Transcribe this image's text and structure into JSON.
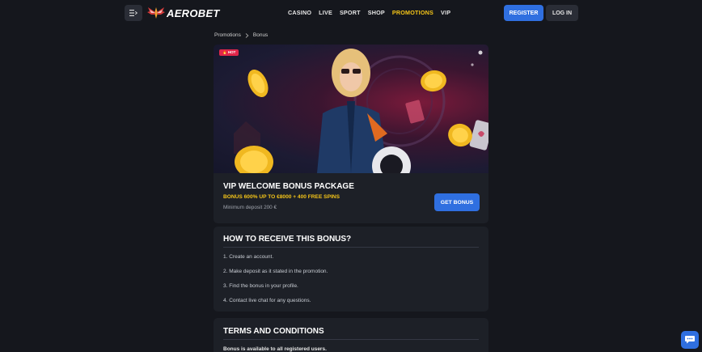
{
  "header": {
    "logo_text": "AEROBET",
    "nav": [
      {
        "label": "CASINO",
        "active": false
      },
      {
        "label": "LIVE",
        "active": false
      },
      {
        "label": "SPORT",
        "active": false
      },
      {
        "label": "SHOP",
        "active": false
      },
      {
        "label": "PROMOTIONS",
        "active": true
      },
      {
        "label": "VIP",
        "active": false
      }
    ],
    "register_label": "REGISTER",
    "login_label": "LOG IN"
  },
  "breadcrumb": {
    "items": [
      "Promotions",
      "Bonus"
    ]
  },
  "banner": {
    "badge": "🔥 HOT"
  },
  "promo": {
    "title": "VIP WELCOME BONUS PACKAGE",
    "subtitle": "BONUS 600% UP TO €8000 + 400 FREE SPINS",
    "minimum": "Minimum deposit 200 €",
    "button_label": "GET BONUS"
  },
  "howto": {
    "title": "HOW TO RECEIVE THIS BONUS?",
    "steps": [
      "1. Create an account.",
      "2. Make deposit as it stated in the promotion.",
      "3. Find the bonus in your profile.",
      "4. Contact live chat for any questions."
    ]
  },
  "terms": {
    "title": "TERMS AND CONDITIONS",
    "first_line": "Bonus is available to all registered users."
  },
  "colors": {
    "accent_blue": "#2f6fe0",
    "accent_yellow": "#f5c518",
    "hot_red": "#e0264a",
    "background": "#15171d",
    "card": "#1d2027"
  },
  "icons": {
    "menu": "menu-icon",
    "chevron": "chevron-right-icon",
    "chat": "chat-icon",
    "logo": "wings-logo-icon"
  }
}
